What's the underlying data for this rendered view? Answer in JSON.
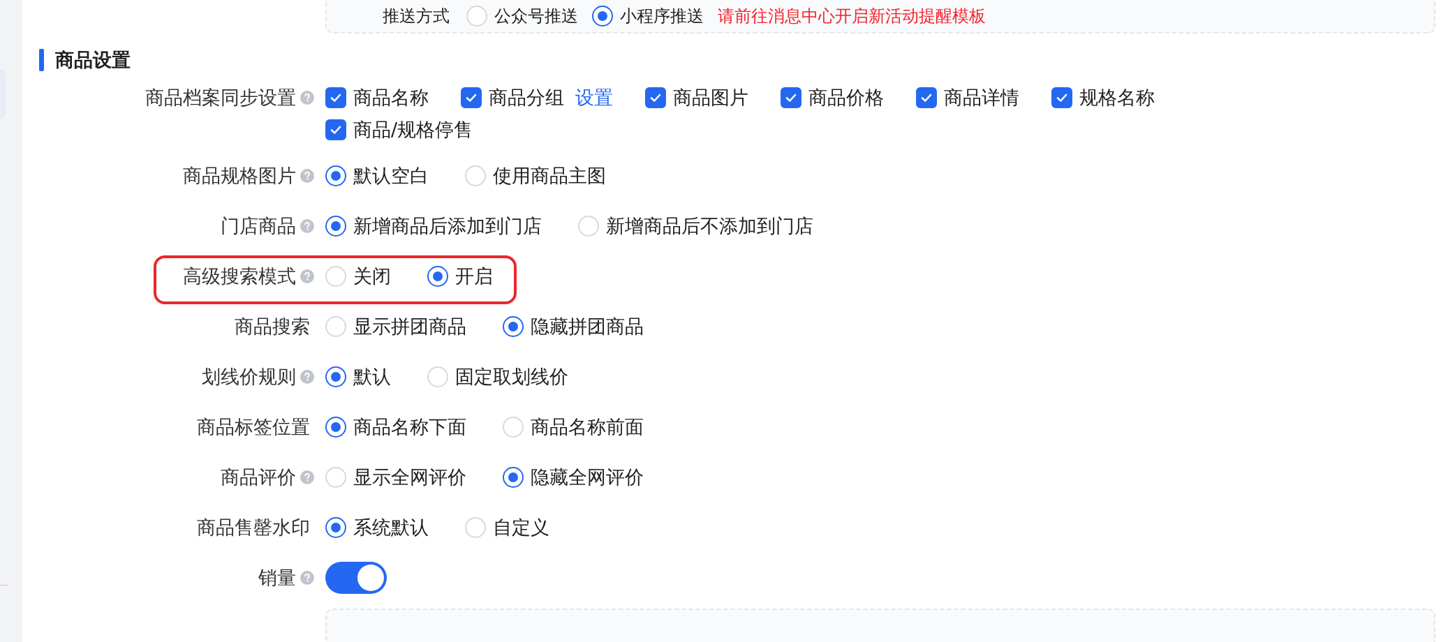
{
  "push_panel": {
    "label": "推送方式",
    "options": [
      {
        "label": "公众号推送",
        "selected": false
      },
      {
        "label": "小程序推送",
        "selected": true
      }
    ],
    "notice": "请前往消息中心开启新活动提醒模板"
  },
  "section": {
    "title": "商品设置"
  },
  "rows": [
    {
      "kind": "checkboxes",
      "label": "商品档案同步设置",
      "help": true,
      "highlighted": false,
      "options": [
        {
          "label": "商品名称",
          "checked": true
        },
        {
          "label": "商品分组",
          "checked": true,
          "link": "设置"
        },
        {
          "label": "商品图片",
          "checked": true
        },
        {
          "label": "商品价格",
          "checked": true
        },
        {
          "label": "商品详情",
          "checked": true
        },
        {
          "label": "规格名称",
          "checked": true
        },
        {
          "label": "商品/规格停售",
          "checked": true
        }
      ]
    },
    {
      "kind": "radio",
      "label": "商品规格图片",
      "help": true,
      "highlighted": false,
      "options": [
        {
          "label": "默认空白",
          "selected": true
        },
        {
          "label": "使用商品主图",
          "selected": false
        }
      ]
    },
    {
      "kind": "radio",
      "label": "门店商品",
      "help": true,
      "highlighted": false,
      "options": [
        {
          "label": "新增商品后添加到门店",
          "selected": true
        },
        {
          "label": "新增商品后不添加到门店",
          "selected": false
        }
      ]
    },
    {
      "kind": "radio",
      "label": "高级搜索模式",
      "help": true,
      "highlighted": true,
      "options": [
        {
          "label": "关闭",
          "selected": false
        },
        {
          "label": "开启",
          "selected": true
        }
      ]
    },
    {
      "kind": "radio",
      "label": "商品搜索",
      "help": false,
      "highlighted": false,
      "options": [
        {
          "label": "显示拼团商品",
          "selected": false
        },
        {
          "label": "隐藏拼团商品",
          "selected": true
        }
      ]
    },
    {
      "kind": "radio",
      "label": "划线价规则",
      "help": true,
      "highlighted": false,
      "options": [
        {
          "label": "默认",
          "selected": true
        },
        {
          "label": "固定取划线价",
          "selected": false
        }
      ]
    },
    {
      "kind": "radio",
      "label": "商品标签位置",
      "help": false,
      "highlighted": false,
      "options": [
        {
          "label": "商品名称下面",
          "selected": true
        },
        {
          "label": "商品名称前面",
          "selected": false
        }
      ]
    },
    {
      "kind": "radio",
      "label": "商品评价",
      "help": true,
      "highlighted": false,
      "options": [
        {
          "label": "显示全网评价",
          "selected": false
        },
        {
          "label": "隐藏全网评价",
          "selected": true
        }
      ]
    },
    {
      "kind": "radio",
      "label": "商品售罄水印",
      "help": false,
      "highlighted": false,
      "options": [
        {
          "label": "系统默认",
          "selected": true
        },
        {
          "label": "自定义",
          "selected": false
        }
      ]
    },
    {
      "kind": "switch",
      "label": "销量",
      "help": true,
      "highlighted": false,
      "on": true
    }
  ]
}
